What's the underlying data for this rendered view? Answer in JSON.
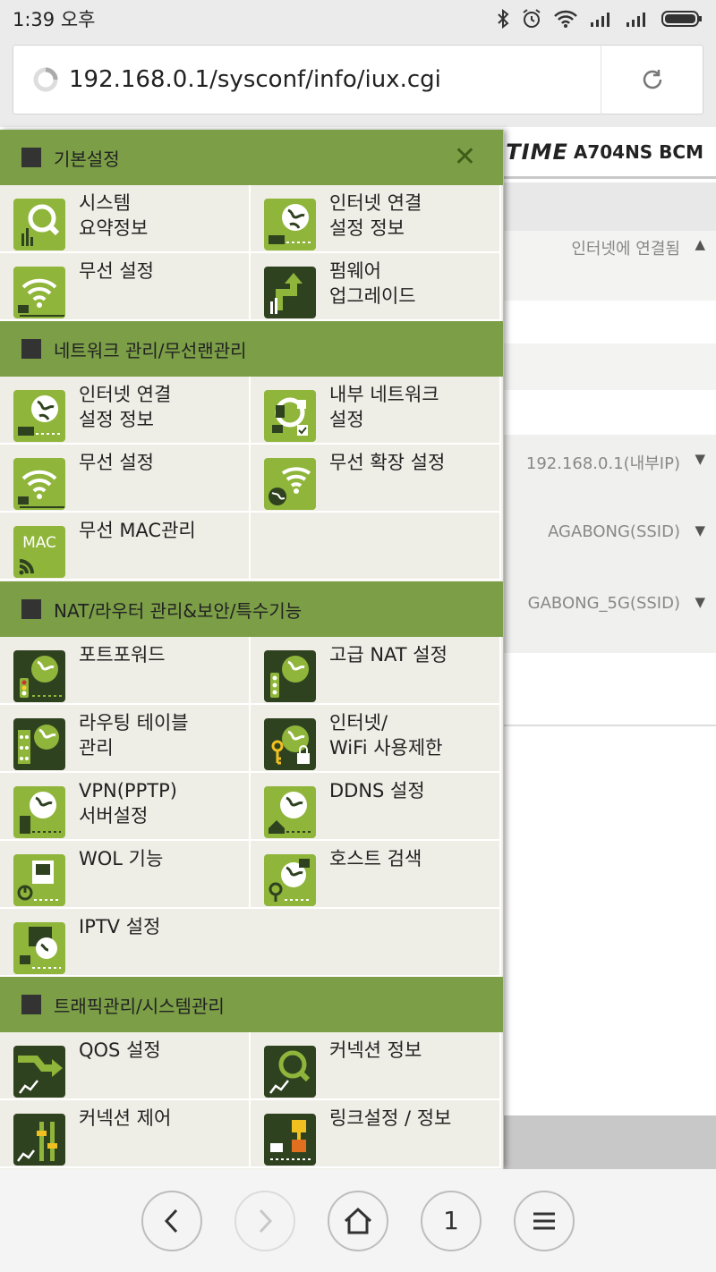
{
  "status": {
    "time": "1:39 오후"
  },
  "browser": {
    "url": "192.168.0.1/sysconf/info/iux.cgi"
  },
  "bg_page": {
    "brand": "TIME",
    "model": "A704NS BCM",
    "rows": [
      "인터넷에 연결됨",
      "192.168.0.1(내부IP)",
      "AGABONG(SSID)",
      "GABONG_5G(SSID)"
    ]
  },
  "menu": {
    "sections": [
      {
        "title": "기본설정",
        "items": [
          "시스템\n요약정보",
          "인터넷 연결\n설정 정보",
          "무선 설정",
          "펌웨어\n업그레이드"
        ]
      },
      {
        "title": "네트워크 관리/무선랜관리",
        "items": [
          "인터넷 연결\n설정 정보",
          "내부 네트워크\n설정",
          "무선 설정",
          "무선 확장 설정",
          "무선 MAC관리"
        ]
      },
      {
        "title": "NAT/라우터 관리&보안/특수기능",
        "items": [
          "포트포워드",
          "고급 NAT 설정",
          "라우팅 테이블\n관리",
          "인터넷/\nWiFi 사용제한",
          "VPN(PPTP)\n서버설정",
          "DDNS 설정",
          "WOL 기능",
          "호스트 검색",
          "IPTV 설정"
        ]
      },
      {
        "title": "트래픽관리/시스템관리",
        "items": [
          "QOS 설정",
          "커넥션 정보",
          "커넥션 제어",
          "링크설정 / 정보"
        ]
      }
    ],
    "mac_icon_text": "MAC"
  },
  "nav": {
    "tab_count": "1"
  },
  "colors": {
    "section_bg": "#7b9e47",
    "icon_green": "#8fb53a",
    "icon_dark": "#2f4220",
    "panel_bg": "#efeee6"
  }
}
